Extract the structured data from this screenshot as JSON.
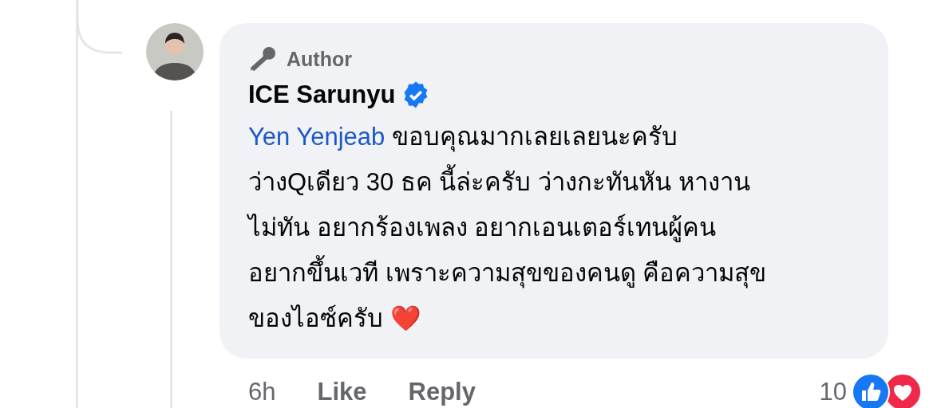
{
  "comment": {
    "badge": "Author",
    "author": "ICE Sarunyu",
    "verified": true,
    "mention": {
      "text": "Yen Yenjeab"
    },
    "lines": [
      " ขอบคุณมากเลยเลยนะครับ",
      "ว่างQเดียว 30 ธค นี้ล่ะครับ ว่างกะทันหัน หางาน",
      "ไม่ทัน อยากร้องเพลง อยากเอนเตอร์เทนผู้คน",
      "อยากขึ้นเวที เพราะความสุขของคนดู คือความสุข",
      "ของไอซ์ครับ ❤️"
    ]
  },
  "footer": {
    "time": "6h",
    "actions": [
      "Like",
      "Reply"
    ],
    "reaction_count": "10",
    "reactions": [
      {
        "kind": "like"
      },
      {
        "kind": "love"
      }
    ]
  }
}
